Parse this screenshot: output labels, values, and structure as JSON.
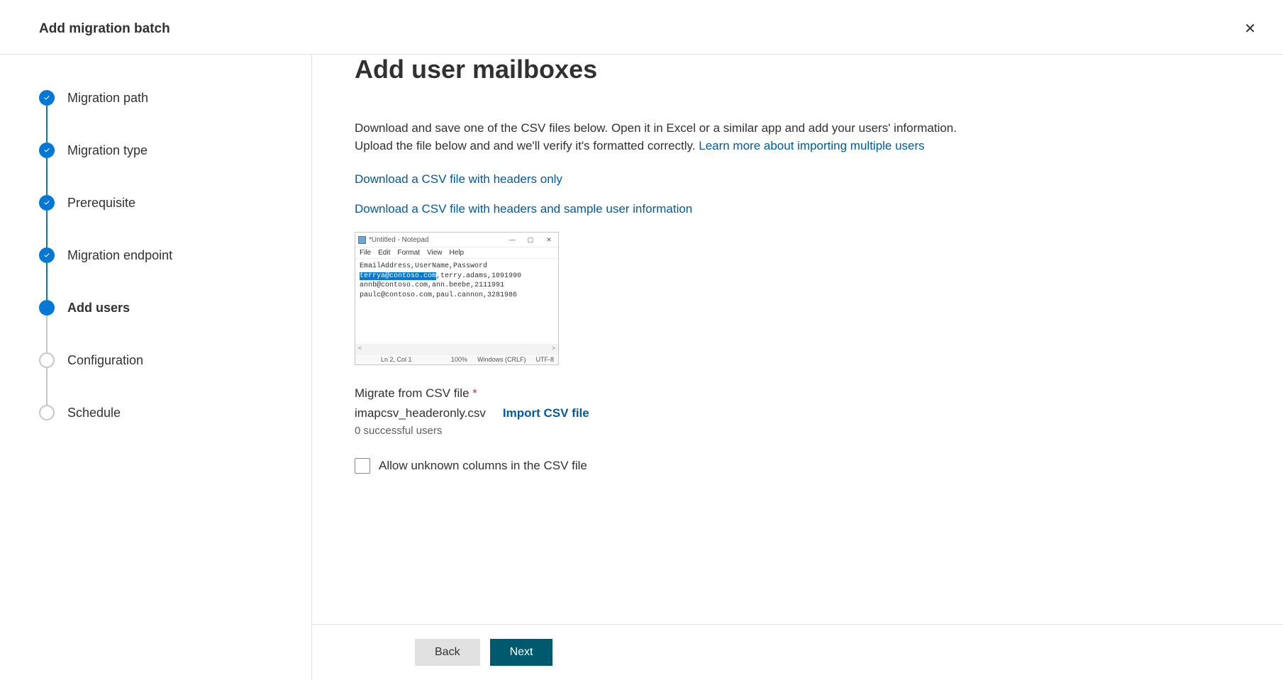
{
  "header": {
    "title": "Add migration batch"
  },
  "steps": [
    {
      "label": "Migration path",
      "state": "done"
    },
    {
      "label": "Migration type",
      "state": "done"
    },
    {
      "label": "Prerequisite",
      "state": "done"
    },
    {
      "label": "Migration endpoint",
      "state": "done"
    },
    {
      "label": "Add users",
      "state": "current"
    },
    {
      "label": "Configuration",
      "state": "pending"
    },
    {
      "label": "Schedule",
      "state": "pending"
    }
  ],
  "main": {
    "title": "Add user mailboxes",
    "desc1": "Download and save one of the CSV files below. Open it in Excel or a similar app and add your users' information. Upload the file below and and we'll verify it's formatted correctly. ",
    "learnMore": "Learn more about importing multiple users",
    "dl1": "Download a CSV file with headers only",
    "dl2": "Download a CSV file with headers and sample user information",
    "fieldLabel": "Migrate from CSV file ",
    "required": "*",
    "fileName": "imapcsv_headeronly.csv",
    "importLabel": "Import CSV file",
    "statusText": "0 successful users",
    "cbLabel": "Allow unknown columns in the CSV file"
  },
  "notepad": {
    "title": "*Untitled - Notepad",
    "menus": [
      "File",
      "Edit",
      "Format",
      "View",
      "Help"
    ],
    "line1": "EmailAddress,UserName,Password",
    "line2a": "terrya@contoso.com",
    "line2b": ",terry.adams,1091990",
    "line3": "annb@contoso.com,ann.beebe,2111991",
    "line4": "paulc@contoso.com,paul.cannon,3281986",
    "status": {
      "pos": "Ln 2, Col 1",
      "zoom": "100%",
      "eol": "Windows (CRLF)",
      "enc": "UTF-8"
    }
  },
  "footer": {
    "back": "Back",
    "next": "Next"
  }
}
